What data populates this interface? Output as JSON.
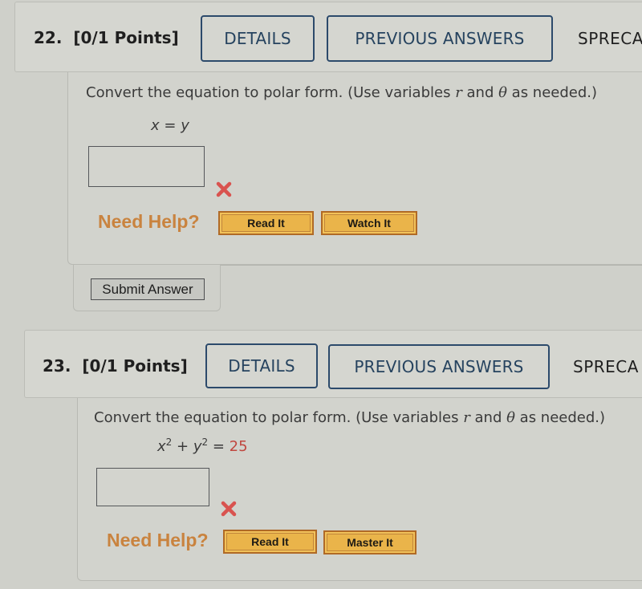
{
  "questions": [
    {
      "number": "22.",
      "points": "[0/1 Points]",
      "details_label": "DETAILS",
      "previous_answers_label": "PREVIOUS ANSWERS",
      "course_code": "SPRECA",
      "prompt_before_r": "Convert the equation to polar form. (Use variables ",
      "var_r": "r",
      "prompt_and": " and ",
      "var_theta": "θ",
      "prompt_after": " as needed.)",
      "equation": {
        "lhs_x": "x",
        "op": " = ",
        "rhs_y": "y"
      },
      "answer_value": "",
      "answer_status": "incorrect",
      "need_help_label": "Need Help?",
      "help_buttons": [
        "Read It",
        "Watch It"
      ],
      "submit_label": "Submit Answer"
    },
    {
      "number": "23.",
      "points": "[0/1 Points]",
      "details_label": "DETAILS",
      "previous_answers_label": "PREVIOUS ANSWERS",
      "course_code": "SPRECA",
      "prompt_before_r": "Convert the equation to polar form. (Use variables ",
      "var_r": "r",
      "prompt_and": " and ",
      "var_theta": "θ",
      "prompt_after": " as needed.)",
      "equation": {
        "x": "x",
        "exp1": "2",
        "plus": " + ",
        "y": "y",
        "exp2": "2",
        "eq": " = ",
        "rhs": "25"
      },
      "answer_value": "",
      "answer_status": "incorrect",
      "need_help_label": "Need Help?",
      "help_buttons": [
        "Read It",
        "Master It"
      ]
    }
  ],
  "colors": {
    "background": "#cfd0ca",
    "header_button_border": "#2c4a6b",
    "need_help": "#c9833f",
    "help_button": "#eab44a",
    "wrong_mark": "#d9534f",
    "equation_constant": "#c0473f"
  }
}
